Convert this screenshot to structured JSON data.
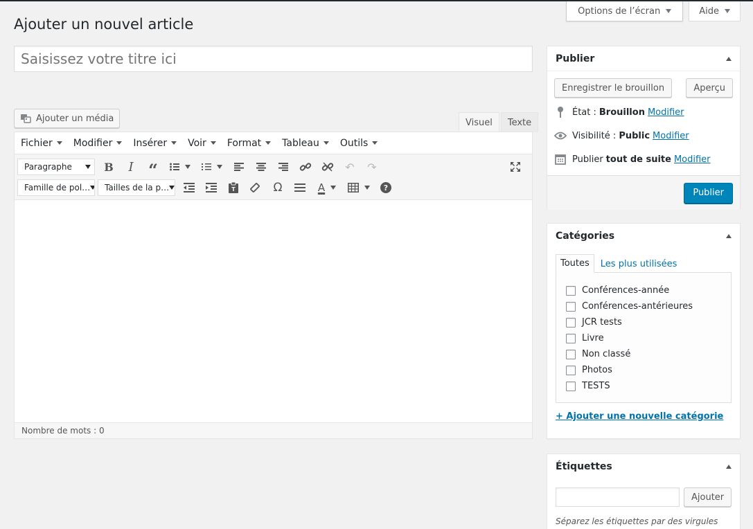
{
  "screen_meta": {
    "screen_options_label": "Options de l’écran",
    "help_label": "Aide"
  },
  "page_title": "Ajouter un nouvel article",
  "title_field": {
    "placeholder": "Saisissez votre titre ici",
    "value": ""
  },
  "media_button_label": "Ajouter un média",
  "editor_tabs": {
    "visual": "Visuel",
    "text": "Texte",
    "active": "visual"
  },
  "menubar": [
    "Fichier",
    "Modifier",
    "Insérer",
    "Voir",
    "Format",
    "Tableau",
    "Outils"
  ],
  "toolbar": {
    "format_select": "Paragraphe",
    "font_family_select": "Famille de pol…",
    "font_size_select": "Tailles de la p…"
  },
  "status_bar": {
    "word_count": "Nombre de mots : 0"
  },
  "publish_box": {
    "title": "Publier",
    "save_draft": "Enregistrer le brouillon",
    "preview": "Aperçu",
    "status_label": "État :",
    "status_value": "Brouillon",
    "visibility_label": "Visibilité :",
    "visibility_value": "Public",
    "publish_label": "Publier",
    "publish_value": "tout de suite",
    "edit_link": "Modifier",
    "publish_button": "Publier"
  },
  "categories_box": {
    "title": "Catégories",
    "tab_all": "Toutes",
    "tab_popular": "Les plus utilisées",
    "items": [
      "Conférences-année",
      "Conférences-antérieures",
      "JCR tests",
      "Livre",
      "Non classé",
      "Photos",
      "TESTS"
    ],
    "add_new": "+ Ajouter une nouvelle catégorie"
  },
  "tags_box": {
    "title": "Étiquettes",
    "add_button": "Ajouter",
    "hint": "Séparez les étiquettes par des virgules"
  },
  "colors": {
    "primary": "#0085ba",
    "link": "#0073aa",
    "background": "#f1f1f1"
  }
}
